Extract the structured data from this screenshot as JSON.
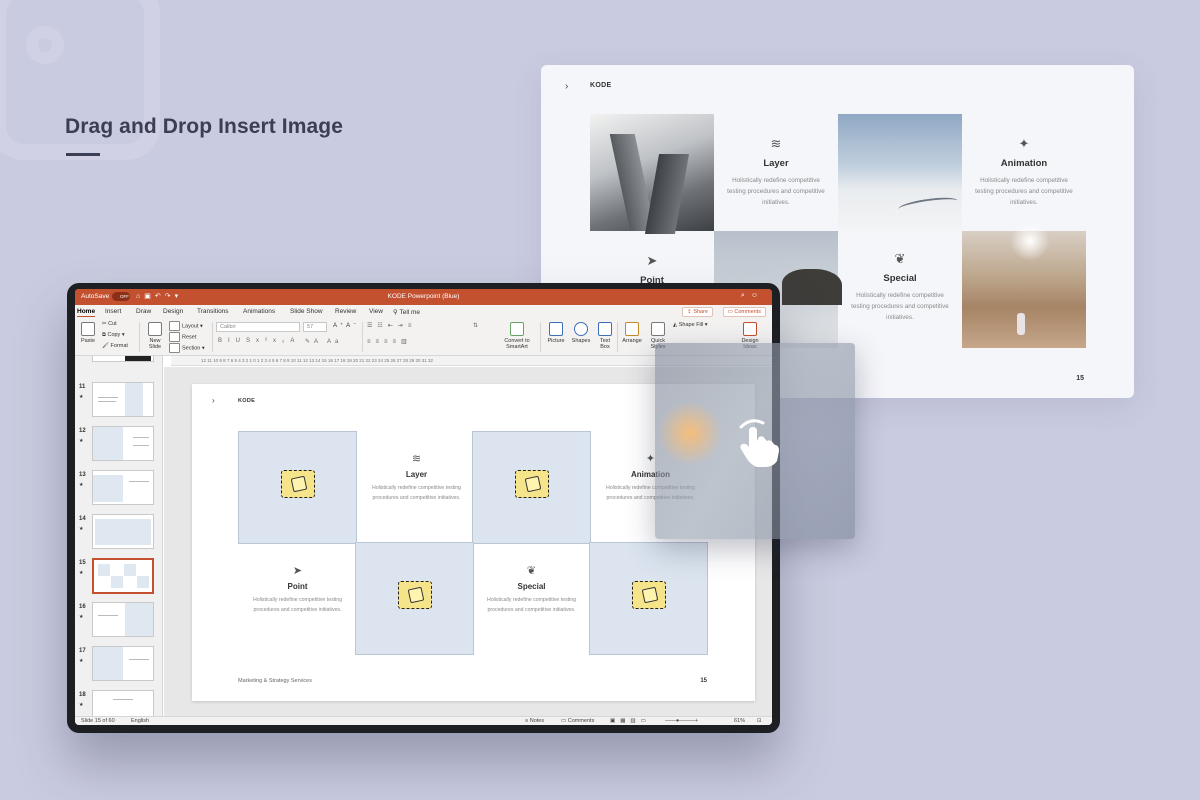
{
  "headline": "Drag and Drop Insert Image",
  "preview": {
    "chevron": "›",
    "brand": "KODE",
    "page_number": "15",
    "layer": {
      "title": "Layer",
      "desc": "Holistically redefine competitive testing procedures and competitive initiatives."
    },
    "animation": {
      "title": "Animation",
      "desc": "Holistically redefine competitive testing procedures and competitive initiatives."
    },
    "point": {
      "title": "Point"
    },
    "special": {
      "title": "Special",
      "desc": "Holistically redefine competitive testing procedures and competitive initiatives."
    }
  },
  "app": {
    "autosave_label": "AutoSave",
    "autosave_state": "OFF",
    "doc_title": "KODE Powerpoint (Blue)",
    "tabs": [
      "Home",
      "Insert",
      "Draw",
      "Design",
      "Transitions",
      "Animations",
      "Slide Show",
      "Review",
      "View",
      "Tell me"
    ],
    "share_label": "Share",
    "comments_label": "Comments",
    "ribbon": {
      "paste": "Paste",
      "cut": "Cut",
      "copy": "Copy",
      "format": "Format",
      "new_slide": "New Slide",
      "layout": "Layout",
      "reset": "Reset",
      "section": "Section",
      "font_name": "Calibri",
      "font_size": "57",
      "convert_smartart": "Convert to SmartArt",
      "picture": "Picture",
      "shapes": "Shapes",
      "text_box": "Text Box",
      "arrange": "Arrange",
      "quick_styles": "Quick Styles",
      "shape_fill": "Shape Fill",
      "design_ideas": "Design Ideas"
    },
    "ruler_text": "12 11 10 9 8 7 6 5 4 3 2 1 0 1 2 3 4 5 6 7 8 9 10 11 12 13 14 15 16 17 18 19 20 21 22 23 24 25 26 27 28 29 30 31 32",
    "thumbnail_numbers": [
      "11",
      "12",
      "13",
      "14",
      "15",
      "16",
      "17",
      "18"
    ],
    "status": {
      "slide_info": "Slide 15 of 60",
      "language": "English",
      "notes": "Notes",
      "comments": "Comments",
      "zoom": "61%"
    }
  },
  "slide": {
    "chevron": "›",
    "brand": "KODE",
    "layer": {
      "title": "Layer",
      "desc": "Holistically redefine competitive testing procedures and competitive initiatives."
    },
    "animation": {
      "title": "Animation",
      "desc": "Holistically redefine competitive testing procedures and competitive initiatives."
    },
    "point": {
      "title": "Point",
      "desc": "Holistically redefine competitive testing procedures and competitive initiatives."
    },
    "special": {
      "title": "Special",
      "desc": "Holistically redefine competitive testing procedures and competitive initiatives."
    },
    "footer": "Marketing & Strategy Services",
    "page_number": "15"
  },
  "colors": {
    "background": "#c9cbe0",
    "accent": "#c3502f",
    "placeholder": "#dbe4ef"
  },
  "icons": [
    "layers-icon",
    "magic-wand-icon",
    "cursor-icon",
    "leaf-icon",
    "hand-swipe-icon",
    "image-icon"
  ]
}
